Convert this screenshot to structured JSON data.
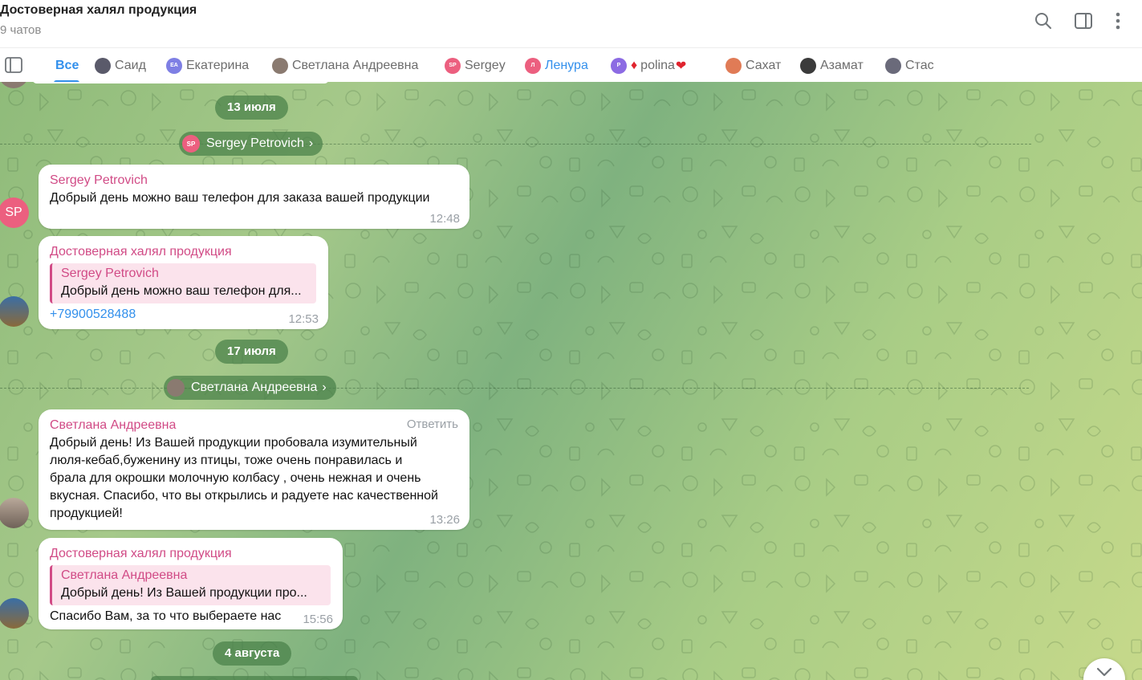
{
  "header": {
    "title": "Достоверная халял продукция",
    "subtitle": "9 чатов"
  },
  "tabs": [
    {
      "label": "Все",
      "avatar_initials": "",
      "avatar_color": ""
    },
    {
      "label": "Саид",
      "avatar_initials": "",
      "avatar_color": "#5a5a6a"
    },
    {
      "label": "Екатерина",
      "avatar_initials": "ЕА",
      "avatar_color": "#7e7fe4"
    },
    {
      "label": "Светлана Андреевна",
      "avatar_initials": "",
      "avatar_color": "#8a7a70"
    },
    {
      "label": "Sergey",
      "avatar_initials": "SP",
      "avatar_color": "#ec5f7f"
    },
    {
      "label": "Ленура",
      "avatar_initials": "Л",
      "avatar_color": "#ec5f7f"
    },
    {
      "label": "polina",
      "avatar_initials": "P",
      "avatar_color": "#8c6be3",
      "emoji_before": "♦",
      "emoji_after": "❤"
    },
    {
      "label": "Сахат",
      "avatar_initials": "",
      "avatar_color": "#e07b56"
    },
    {
      "label": "Азамат",
      "avatar_initials": "",
      "avatar_color": "#3b3b3b"
    },
    {
      "label": "Стас",
      "avatar_initials": "",
      "avatar_color": "#6a6a7a"
    }
  ],
  "chat": {
    "dates": [
      "13 июля",
      "17 июля",
      "4 августа"
    ],
    "sender_pills": [
      {
        "name": "Sergey Petrovich",
        "initials": "SP",
        "color": "#ec5f7f"
      },
      {
        "name": "Светлана Андреевна",
        "initials": "",
        "color": "#8a7a70"
      }
    ],
    "messages": [
      {
        "sender": "Sergey Petrovich",
        "avatar_initials": "SP",
        "avatar_color": "#ec5f7f",
        "text": "Добрый день можно ваш телефон для заказа вашей продукции",
        "time": "12:48"
      },
      {
        "sender": "Достоверная халял продукция",
        "quote_name": "Sergey Petrovich",
        "quote_text": "Добрый день можно ваш телефон для...",
        "text": "+79900528488",
        "time": "12:53"
      },
      {
        "sender": "Светлана Андреевна",
        "reply_label": "Ответить",
        "text_lines": [
          "Добрый день! Из Вашей продукции пробовала изумительный",
          "люля-кебаб,буженину из птицы, тоже очень понравилась и",
          "брала для окрошки молочную колбасу , очень нежная и очень",
          "вкусная. Спасибо, что вы открылись и радуете нас качественной",
          "продукцией!"
        ],
        "time": "13:26"
      },
      {
        "sender": "Достоверная халял продукция",
        "quote_name": "Светлана Андреевна",
        "quote_text": "Добрый день! Из Вашей продукции про...",
        "text": "Спасибо Вам, за то что выбераете нас",
        "time": "15:56"
      }
    ]
  },
  "colors": {
    "accent": "#3390ec",
    "sender_name": "#d14b86",
    "pill_bg": "#4f8a4f"
  }
}
